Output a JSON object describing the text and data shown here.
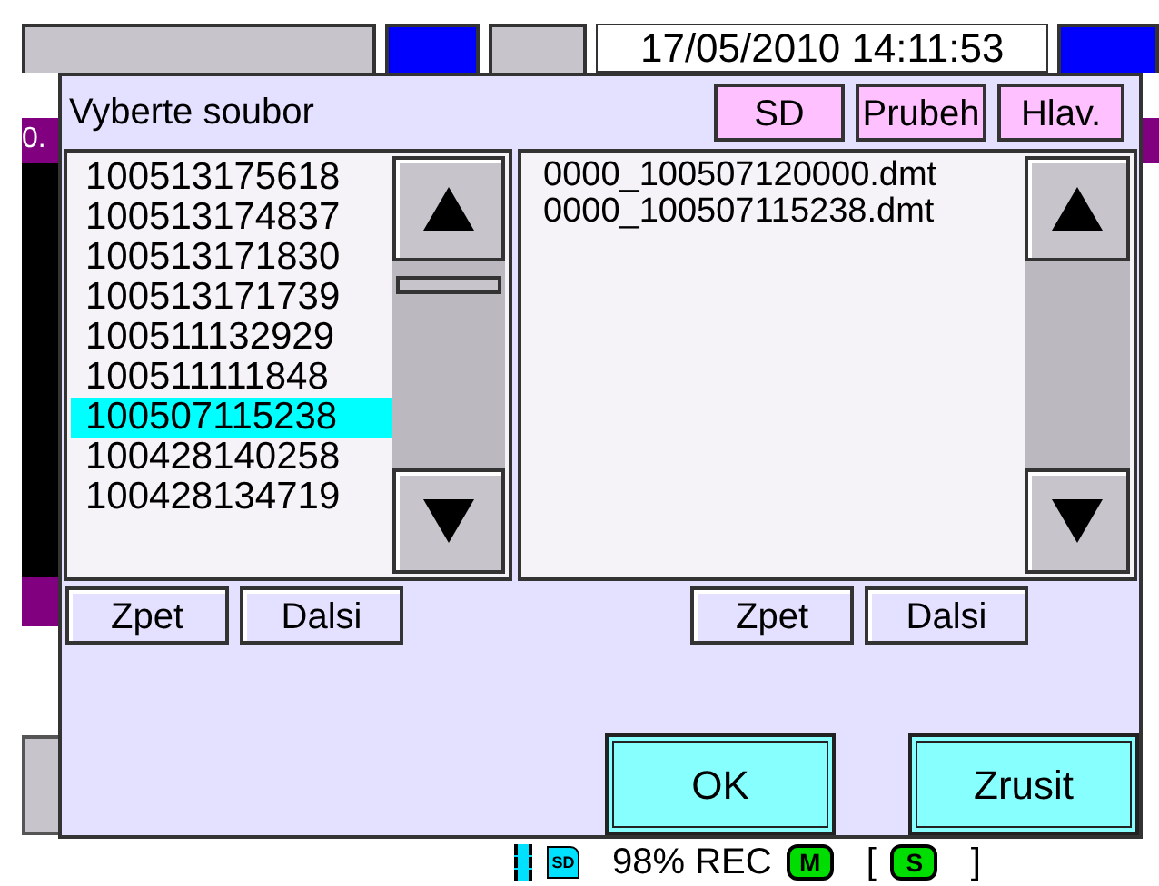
{
  "background": {
    "buttons": [
      {
        "kind": "gray"
      },
      {
        "kind": "blue"
      },
      {
        "kind": "gray"
      },
      {
        "kind": "blue"
      }
    ],
    "datetime": "17/05/2010 14:11:53",
    "side_value": "0."
  },
  "dialog": {
    "title": "Vyberte soubor",
    "header_buttons": [
      "SD",
      "Prubeh",
      "Hlav."
    ],
    "folders": [
      {
        "label": "100513175618",
        "selected": false
      },
      {
        "label": "100513174837",
        "selected": false
      },
      {
        "label": "100513171830",
        "selected": false
      },
      {
        "label": "100513171739",
        "selected": false
      },
      {
        "label": "100511132929",
        "selected": false
      },
      {
        "label": "100511111848",
        "selected": false
      },
      {
        "label": "100507115238",
        "selected": true
      },
      {
        "label": "100428140258",
        "selected": false
      },
      {
        "label": "100428134719",
        "selected": false
      }
    ],
    "files": [
      {
        "label": "0000_100507120000.dmt",
        "selected": false
      },
      {
        "label": "0000_100507115238.dmt",
        "selected": false
      }
    ],
    "folder_nav": [
      "Zpet",
      "Dalsi"
    ],
    "file_nav": [
      "Zpet",
      "Dalsi"
    ],
    "buttons": [
      "OK",
      "Zrusit"
    ]
  },
  "status_bar": {
    "items": [
      {
        "kind": "chip"
      },
      {
        "kind": "card",
        "label": "SD"
      },
      {
        "kind": "text",
        "label": "98% REC"
      },
      {
        "kind": "badge",
        "label": "M"
      },
      {
        "kind": "text",
        "label": "["
      },
      {
        "kind": "badge",
        "label": "S"
      },
      {
        "kind": "text",
        "label": "]"
      }
    ]
  }
}
